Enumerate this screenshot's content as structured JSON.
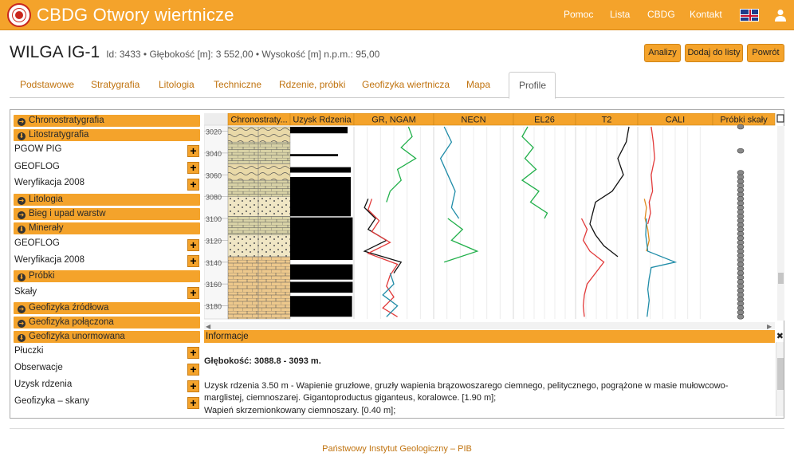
{
  "app": {
    "title": "CBDG Otwory wiertnicze",
    "nav": [
      "Pomoc",
      "Lista",
      "CBDG",
      "Kontakt"
    ]
  },
  "well": {
    "name": "WILGA IG-1",
    "meta": "Id: 3433 • Głębokość [m]: 3 552,00 • Wysokość [m] n.p.m.: 95,00"
  },
  "actions": [
    "Analizy",
    "Dodaj do listy",
    "Powrót"
  ],
  "tabs": [
    "Podstawowe",
    "Stratygrafia",
    "Litologia",
    "Techniczne",
    "Rdzenie, próbki",
    "Geofizyka wiertnicza",
    "Mapa",
    "Profile"
  ],
  "active_tab": "Profile",
  "sidebar": {
    "chrono": "Chronostratygrafia",
    "lito": "Litostratygrafia",
    "lito_items": [
      "PGOW PIG",
      "GEOFLOG",
      "Weryfikacja 2008"
    ],
    "litologia": "Litologia",
    "bieg": "Bieg i upad warstw",
    "mineraly": "Minerały",
    "mineral_items": [
      "GEOFLOG",
      "Weryfikacja 2008"
    ],
    "probki": "Próbki",
    "probki_items": [
      "Skały"
    ],
    "geo_zrodlowa": "Geofizyka źródłowa",
    "geo_polaczona": "Geofizyka połączona",
    "geo_unormowana": "Geofizyka unormowana",
    "geo_items": [
      "Płuczki",
      "Obserwacje",
      "Uzysk rdzenia",
      "Geofizyka – skany"
    ]
  },
  "chart_data": {
    "type": "line",
    "depth_axis": {
      "label": "",
      "ticks": [
        3020,
        3040,
        3060,
        3080,
        3100,
        3120,
        3140,
        3160,
        3180
      ],
      "range": [
        3016,
        3192
      ]
    },
    "columns": [
      "Chronostraty...",
      "Uzysk Rdzenia",
      "GR, NGAM",
      "NECN",
      "EL26",
      "T2",
      "CALI",
      "Próbki skały"
    ],
    "core_recovery": [
      {
        "from": 3016,
        "to": 3022,
        "value": 0.9
      },
      {
        "from": 3041,
        "to": 3043,
        "value": 0.75
      },
      {
        "from": 3053,
        "to": 3058,
        "value": 0.95
      },
      {
        "from": 3062,
        "to": 3098,
        "value": 0.95
      },
      {
        "from": 3099,
        "to": 3138,
        "value": 0.98
      },
      {
        "from": 3142,
        "to": 3156,
        "value": 0.98
      },
      {
        "from": 3158,
        "to": 3168,
        "value": 0.98
      },
      {
        "from": 3171,
        "to": 3190,
        "value": 0.97
      }
    ],
    "samples_depths": [
      3016,
      3038,
      3058,
      3062,
      3066,
      3070,
      3074,
      3078,
      3082,
      3086,
      3090,
      3094,
      3098,
      3102,
      3106,
      3110,
      3114,
      3118,
      3122,
      3126,
      3130,
      3134,
      3138,
      3142,
      3146,
      3150,
      3154,
      3158,
      3162,
      3166,
      3170,
      3174,
      3178,
      3182,
      3186,
      3190
    ],
    "series": [
      {
        "name": "GR, NGAM",
        "color": "#22b04b",
        "depth": [
          3016,
          3025,
          3035,
          3045,
          3055,
          3065,
          3075,
          3085
        ],
        "values": [
          0.7,
          0.75,
          0.6,
          0.8,
          0.55,
          0.6,
          0.45,
          0.4
        ]
      },
      {
        "name": "GR, NGAM",
        "color": "#111111",
        "depth": [
          3082,
          3090,
          3100,
          3110,
          3120,
          3130,
          3140,
          3150
        ],
        "values": [
          0.15,
          0.1,
          0.25,
          0.15,
          0.4,
          0.1,
          0.6,
          0.5
        ]
      },
      {
        "name": "GR, NGAM",
        "color": "#e23a3a",
        "depth": [
          3082,
          3092,
          3102,
          3112,
          3122,
          3132,
          3142,
          3152,
          3162,
          3172,
          3182,
          3190
        ],
        "values": [
          0.2,
          0.15,
          0.3,
          0.2,
          0.45,
          0.15,
          0.55,
          0.45,
          0.4,
          0.5,
          0.35,
          0.55
        ]
      },
      {
        "name": "GR, NGAM",
        "color": "#1f8ca8",
        "depth": [
          3150,
          3160,
          3170,
          3180,
          3190
        ],
        "values": [
          0.45,
          0.5,
          0.35,
          0.55,
          0.4
        ]
      },
      {
        "name": "NECN",
        "color": "#1f8ca8",
        "depth": [
          3016,
          3030,
          3045,
          3060,
          3075,
          3090,
          3100
        ],
        "values": [
          0.1,
          0.2,
          0.05,
          0.15,
          0.25,
          0.2,
          0.3
        ]
      },
      {
        "name": "NECN",
        "color": "#22b04b",
        "depth": [
          3100,
          3110,
          3120,
          3130,
          3140
        ],
        "values": [
          0.15,
          0.35,
          0.2,
          0.55,
          0.1
        ]
      },
      {
        "name": "EL26",
        "color": "#22b04b",
        "depth": [
          3016,
          3025,
          3035,
          3045,
          3055,
          3065,
          3075,
          3085,
          3095,
          3100
        ],
        "values": [
          0.2,
          0.1,
          0.3,
          0.15,
          0.35,
          0.1,
          0.4,
          0.25,
          0.55,
          0.5
        ]
      },
      {
        "name": "T2",
        "color": "#111111",
        "depth": [
          3016,
          3030,
          3045,
          3060,
          3075,
          3085,
          3095,
          3105,
          3115,
          3125,
          3135
        ],
        "values": [
          0.9,
          0.85,
          0.7,
          0.8,
          0.6,
          0.3,
          0.25,
          0.2,
          0.3,
          0.45,
          0.7
        ]
      },
      {
        "name": "T2",
        "color": "#e23a3a",
        "depth": [
          3100,
          3110,
          3120,
          3130,
          3140,
          3150,
          3160,
          3170,
          3180,
          3190
        ],
        "values": [
          0.05,
          0.15,
          0.08,
          0.2,
          0.45,
          0.3,
          0.15,
          0.1,
          0.08,
          0.1
        ]
      },
      {
        "name": "CALI",
        "color": "#e23a3a",
        "depth": [
          3016,
          3030,
          3045,
          3060,
          3075,
          3085,
          3095,
          3105
        ],
        "values": [
          0.15,
          0.18,
          0.2,
          0.15,
          0.17,
          0.12,
          0.14,
          0.1
        ]
      },
      {
        "name": "CALI",
        "color": "#e08a1e",
        "depth": [
          3082,
          3090,
          3100,
          3110,
          3120,
          3130
        ],
        "values": [
          0.05,
          0.08,
          0.06,
          0.1,
          0.12,
          0.08
        ]
      },
      {
        "name": "CALI",
        "color": "#1f8ca8",
        "depth": [
          3100,
          3115,
          3130,
          3140,
          3145,
          3155,
          3165,
          3175,
          3190
        ],
        "values": [
          0.08,
          0.07,
          0.1,
          0.5,
          0.15,
          0.12,
          0.1,
          0.12,
          0.09
        ]
      }
    ]
  },
  "info": {
    "title": "Informacje",
    "close": "✖",
    "depth": "Głębokość: 3088.8 - 3093 m.",
    "text1": "Uzysk rdzenia 3.50 m - Wapienie gruzłowe, gruzły wapienia brązowoszarego ciemnego, pelitycznego, pogrążone w masie mułowcowo-marglistej, ciemnoszarej. Gigantoproductus giganteus, koralowce. [1.90 m];",
    "text2": "Wapień skrzemionkowany ciemnoszary. [0.40 m];"
  },
  "footer": "Państwowy Instytut Geologiczny – PIB",
  "colors": {
    "accent": "#F4A32B",
    "link": "#c0730f"
  }
}
